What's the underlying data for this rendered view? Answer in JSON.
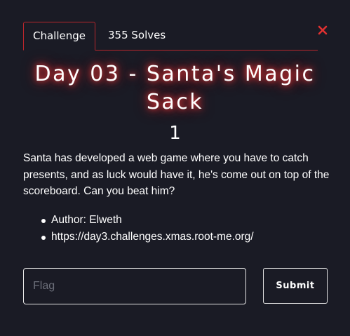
{
  "tabs": {
    "challenge_label": "Challenge",
    "solves_label": "355 Solves"
  },
  "challenge": {
    "title": "Day 03 - Santa's Magic Sack",
    "points": "1",
    "description": "Santa has developed a web game where you have to catch presents, and as luck would have it, he's come out on top of the scoreboard. Can you beat him?",
    "author": "Author: Elweth",
    "link": "https://day3.challenges.xmas.root-me.org/"
  },
  "form": {
    "flag_placeholder": "Flag",
    "flag_value": "",
    "submit_label": "Submit"
  },
  "icons": {
    "close": "close-icon"
  },
  "colors": {
    "background": "#1a1b25",
    "accent_red": "#b8262c",
    "close_red": "#e03131",
    "text": "#ffffff",
    "border_light": "#e6e6e6"
  }
}
